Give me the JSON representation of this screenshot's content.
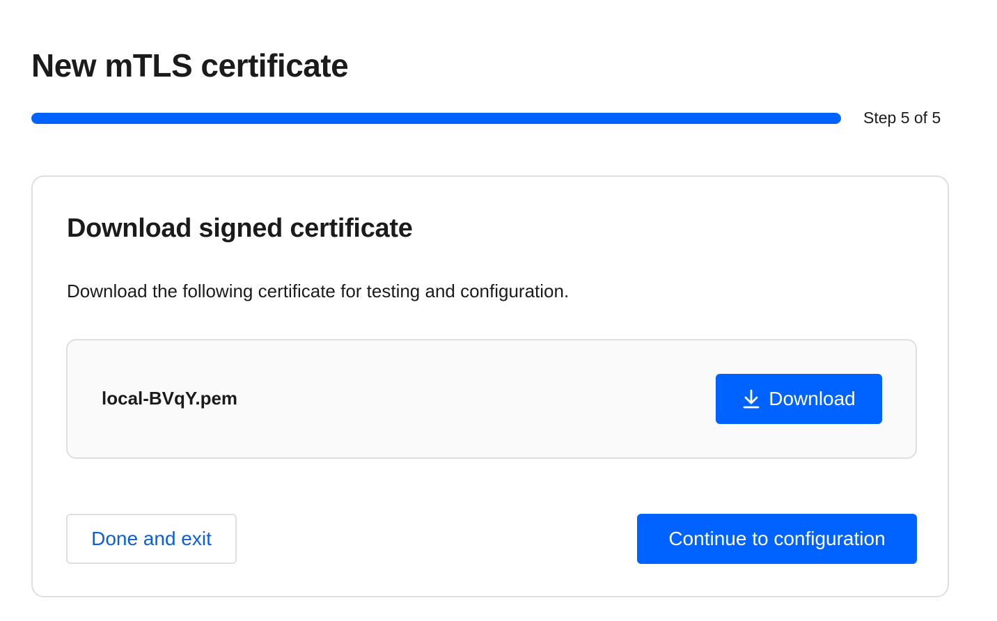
{
  "page": {
    "title": "New mTLS certificate"
  },
  "progress": {
    "step_label": "Step 5 of 5",
    "current_step": 5,
    "total_steps": 5,
    "fraction_complete": 1.0,
    "fill_color": "#0062ff"
  },
  "card": {
    "title": "Download signed certificate",
    "description": "Download the following certificate for testing and configuration."
  },
  "file": {
    "name": "local-BVqY.pem",
    "download_label": "Download",
    "download_icon": "download-icon"
  },
  "actions": {
    "done_label": "Done and exit",
    "continue_label": "Continue to configuration"
  },
  "colors": {
    "accent": "#0062ff",
    "link": "#0a5fdc",
    "border": "#dedfe3"
  }
}
